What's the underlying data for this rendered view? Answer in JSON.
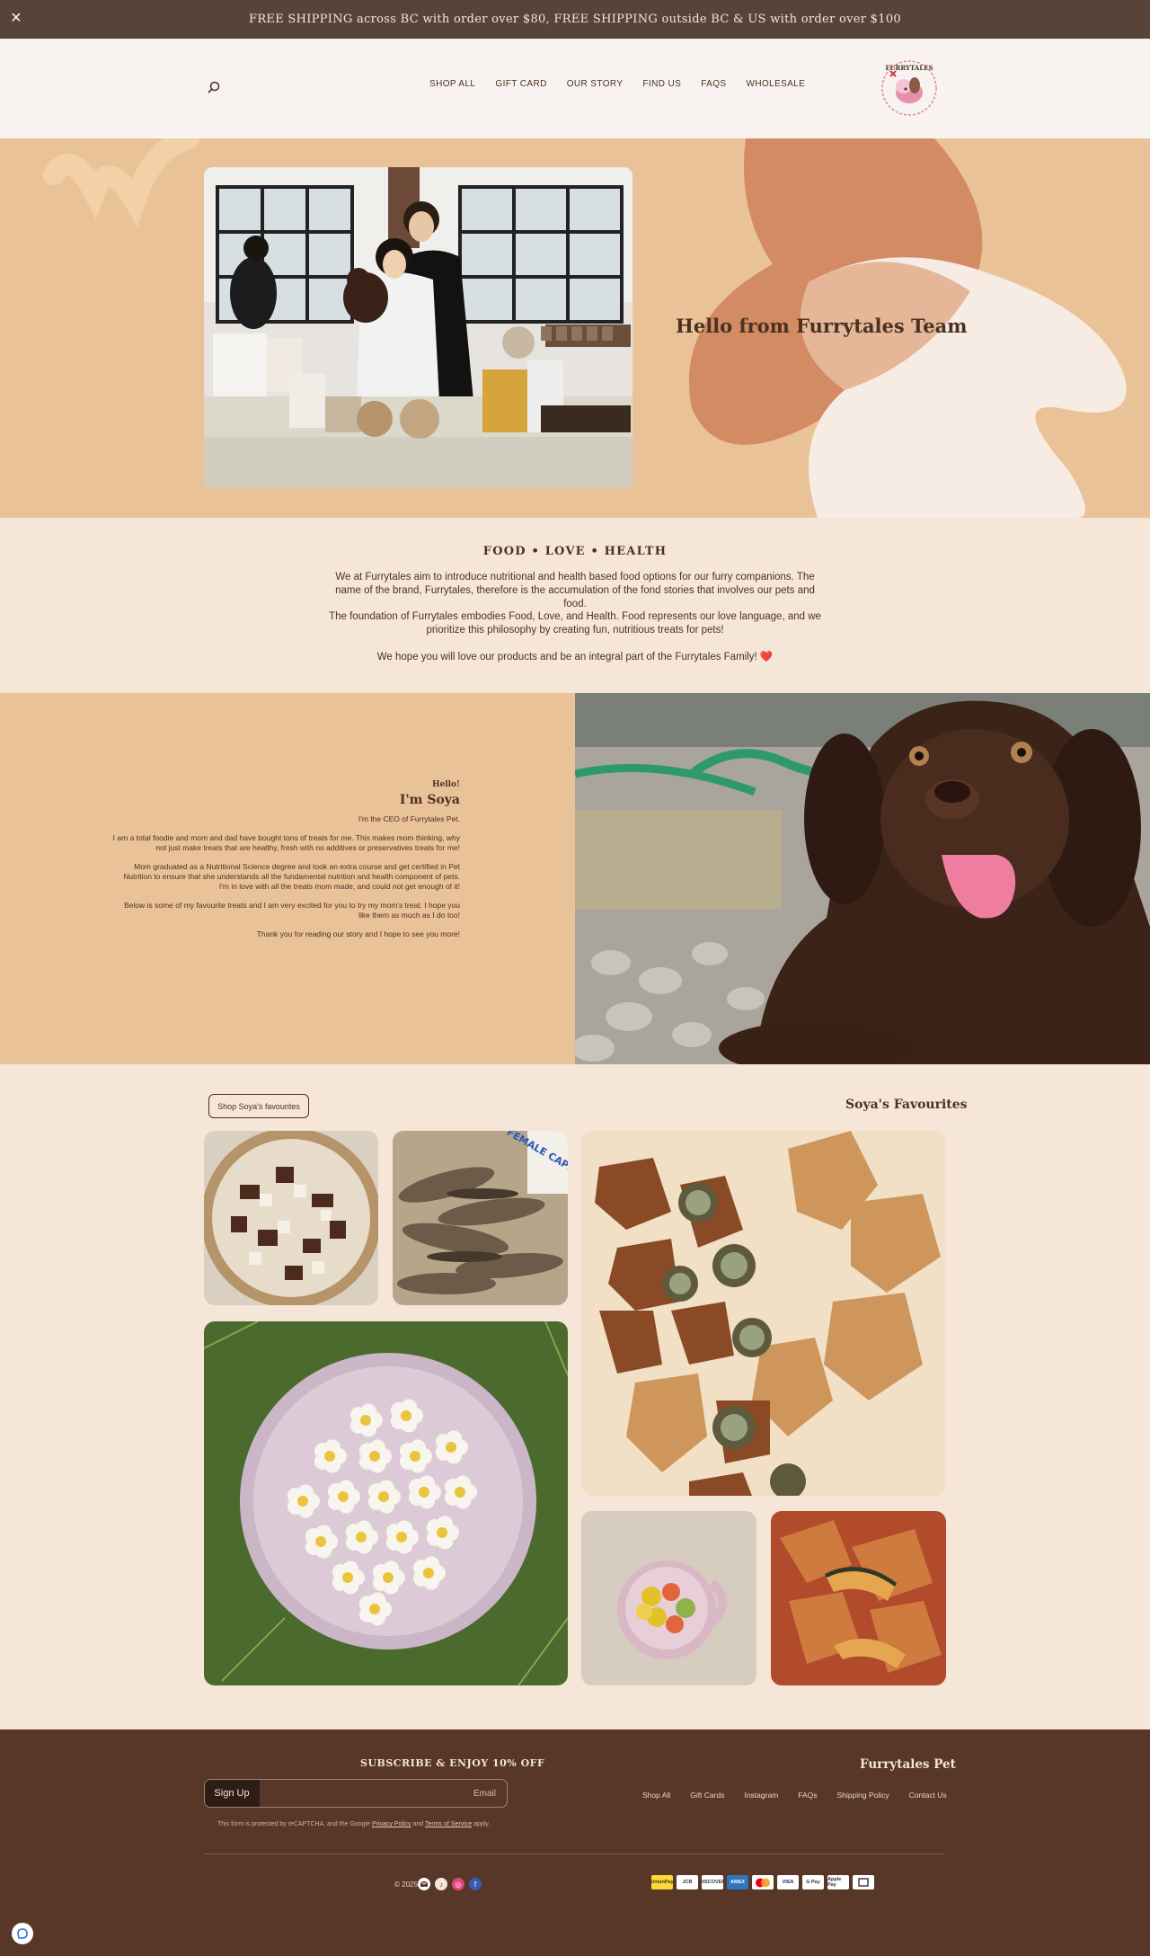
{
  "announcement": {
    "text": "FREE SHIPPING across BC with order over $80, FREE SHIPPING outside BC & US with order over $100",
    "close": "×"
  },
  "header": {
    "logo_text": "FURRYTALES",
    "nav": [
      "SHOP ALL",
      "GIFT CARD",
      "OUR STORY",
      "FIND US",
      "FAQS",
      "WHOLESALE"
    ]
  },
  "hero": {
    "title": "Hello from Furrytales Team"
  },
  "values": {
    "title": "FOOD • LOVE • HEALTH",
    "p1": "We at Furrytales aim to introduce nutritional and health based food options for our furry companions. The name of the brand, Furrytales, therefore is the accumulation of the fond stories that involves our pets and food.",
    "p2": "The foundation of Furrytales embodies Food, Love, and Health. Food represents our love language, and we prioritize this philosophy by creating fun, nutritious treats for pets!",
    "p3": "We hope you will love our products and be an integral part of the Furrytales Family! ❤️"
  },
  "about": {
    "hello": "Hello!",
    "name": "I'm Soya",
    "p1": "I'm the CEO of Furrytales Pet.",
    "p2": "I am a total foodie and mom and dad have bought tons of treats for me. This makes mom thinking, why not just make treats that are healthy, fresh with no additives or preservatives treats for me!",
    "p3": "Mom graduated as a Nutritional Science degree and took an extra course and get certified in Pet Nutrition to ensure that she understands all the fundamental nutrition and health component of pets. I'm in love with all the treats mom made, and could not get enough of it!",
    "p4": "Below is some of my favourite treats and I am very excited for you to try my mom's treat. I hope you like them as much as I do too!",
    "p5": "Thank you for reading our story and I hope to see you more!"
  },
  "favourites": {
    "title": "Soya's Favourites",
    "button": "Shop Soya's favourites",
    "bag_text": "FEMALE CAPELIN"
  },
  "footer": {
    "brand": "Furrytales Pet",
    "links": [
      "Shop All",
      "Gift Cards",
      "Instagram",
      "FAQs",
      "Shipping Policy",
      "Contact Us"
    ],
    "subscribe_title": "SUBSCRIBE & ENJOY 10% OFF",
    "email_placeholder": "Email",
    "signup": "Sign Up",
    "captcha_a": "This form is protected by reCAPTCHA, and the Google ",
    "privacy": "Privacy Policy",
    "captcha_b": " and ",
    "terms": "Terms of Service",
    "captcha_c": " apply.",
    "payments": [
      "Shop Pay",
      "Apple Pay",
      "G Pay",
      "VISA",
      "MC",
      "AMEX",
      "DISCOVER",
      "JCB",
      "UnionPay"
    ],
    "copyright": "© 2025"
  },
  "colors": {
    "announcement": "#584339",
    "header": "#f8f3f0",
    "peach": "#eac298",
    "cream": "#f5e6d8",
    "footer": "#583628",
    "text": "#4a3222"
  }
}
